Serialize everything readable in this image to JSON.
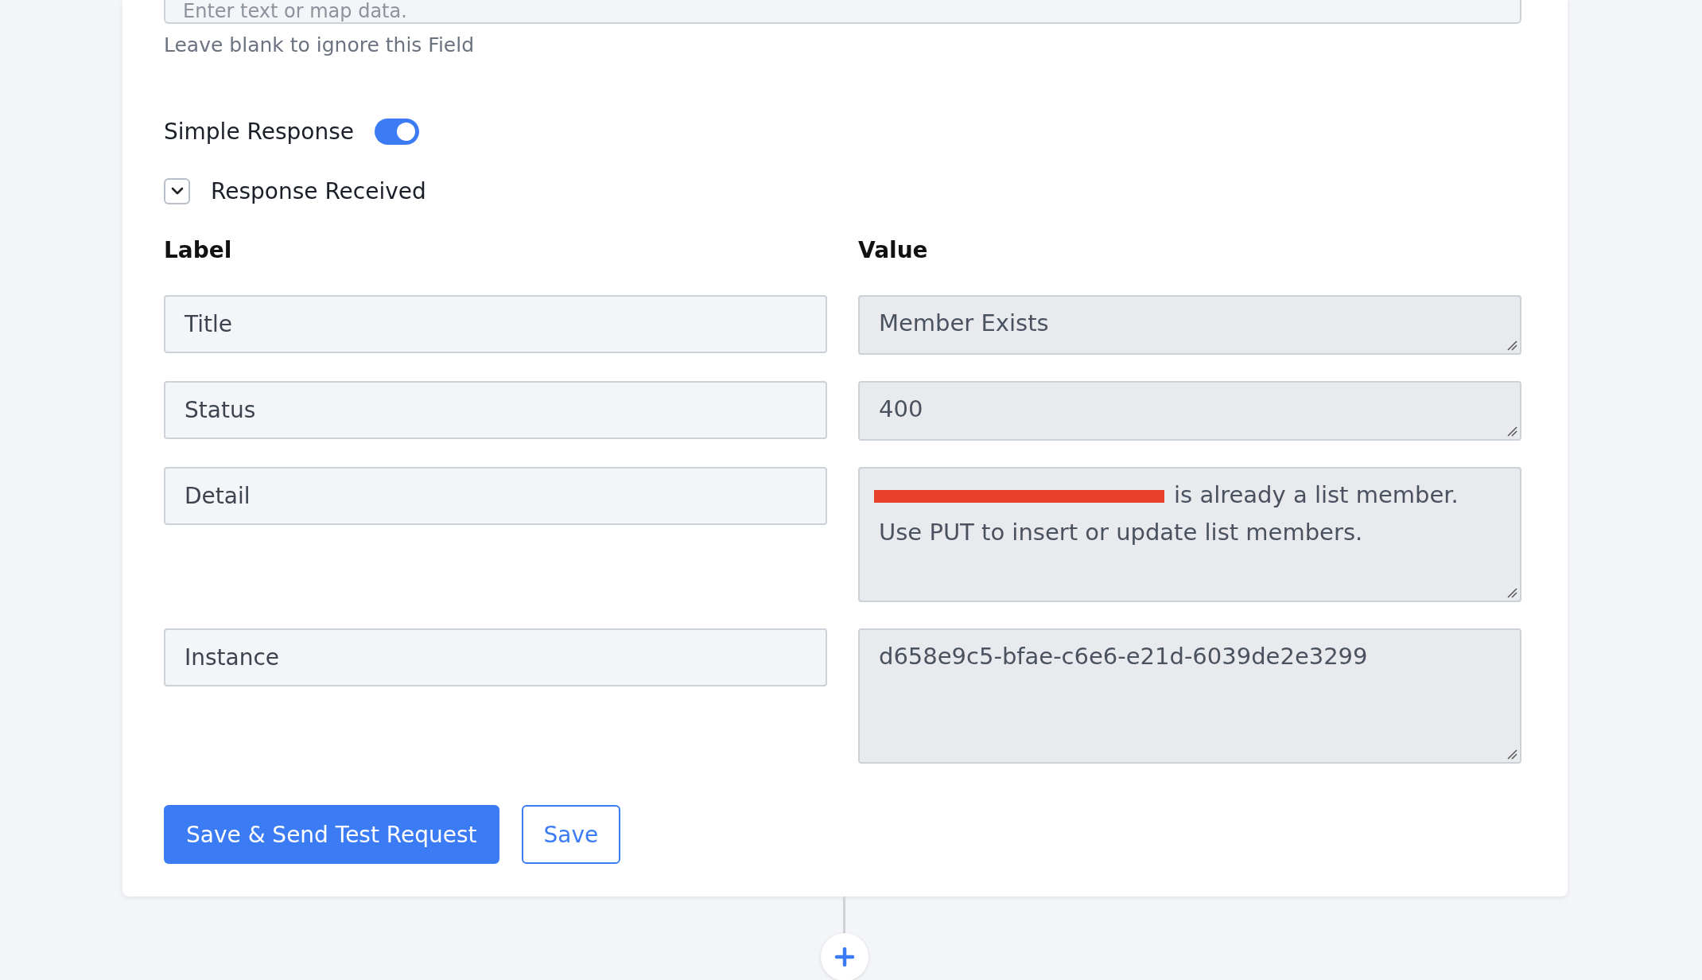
{
  "field": {
    "placeholder": "Enter text or map data.",
    "hint": "Leave blank to ignore this Field"
  },
  "simple_response": {
    "label": "Simple Response",
    "on": true
  },
  "response_received": {
    "label": "Response Received",
    "expanded": true
  },
  "columns": [
    "Label",
    "Value"
  ],
  "rows": [
    {
      "label": "Title",
      "lines": [
        "Member Exists"
      ],
      "redacted": false,
      "kind": "short"
    },
    {
      "label": "Status",
      "lines": [
        "400"
      ],
      "redacted": false,
      "kind": "short"
    },
    {
      "label": "Detail",
      "lines": [
        "is already a list member.",
        "Use PUT to insert or update list members."
      ],
      "redacted": true,
      "kind": "tall"
    },
    {
      "label": "Instance",
      "lines": [
        "d658e9c5-bfae-c6e6-e21d-6039de2e3299"
      ],
      "redacted": false,
      "kind": "tall"
    }
  ],
  "buttons": [
    {
      "label": "Save & Send Test Request",
      "kind": "primary"
    },
    {
      "label": "Save",
      "kind": "secondary"
    }
  ]
}
